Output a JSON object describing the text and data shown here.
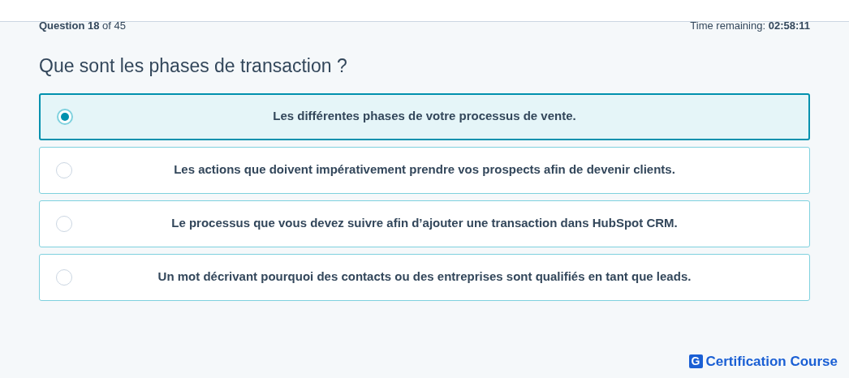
{
  "progress": "**Question 18** of 45",
  "timer": "Time remaining: **02:58:11**",
  "question": "Que sont les phases de transaction ?",
  "options": [
    {
      "label": "Les différentes phases de votre processus de vente.",
      "selected": true
    },
    {
      "label": "Les actions que doivent impérativement prendre vos prospects afin de devenir clients.",
      "selected": false
    },
    {
      "label": "Le processus que vous devez suivre afin d’ajouter une transaction dans HubSpot CRM.",
      "selected": false
    },
    {
      "label": "Un mot décrivant pourquoi des contacts ou des entreprises sont qualifiés en tant que leads.",
      "selected": false
    }
  ],
  "brand": {
    "mark": "G",
    "name": "Certification Course"
  }
}
